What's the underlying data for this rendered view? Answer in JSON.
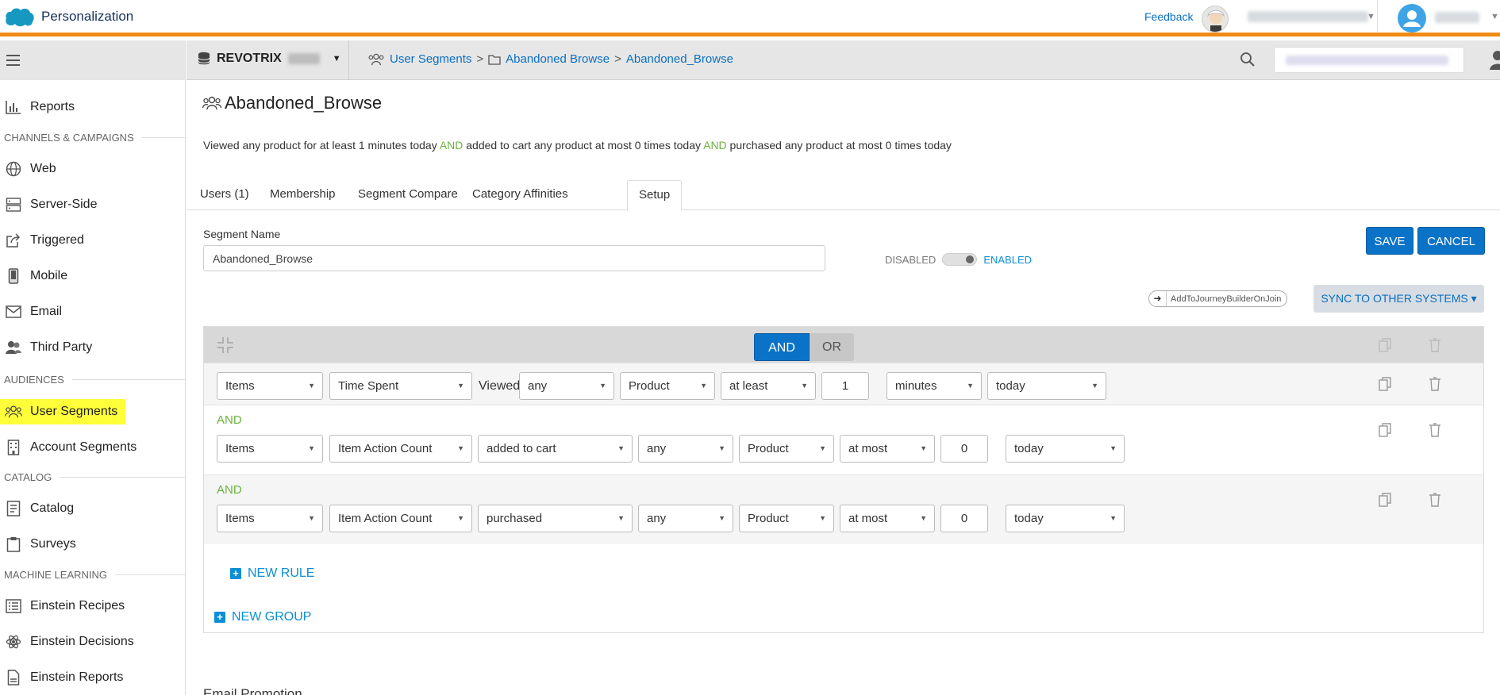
{
  "app": {
    "title": "Personalization",
    "feedback": "Feedback"
  },
  "colors": {
    "accent_orange": "#ef8a13",
    "primary_blue": "#0b73c7",
    "link_blue": "#0b6fc2",
    "operator_green": "#6cb33f",
    "highlight_yellow": "#ffff3a"
  },
  "sidebar": {
    "items": [
      {
        "label": "Reports",
        "icon": "bar-chart-icon"
      },
      {
        "section": "CHANNELS & CAMPAIGNS"
      },
      {
        "label": "Web",
        "icon": "globe-icon"
      },
      {
        "label": "Server-Side",
        "icon": "server-icon"
      },
      {
        "label": "Triggered",
        "icon": "share-icon"
      },
      {
        "label": "Mobile",
        "icon": "mobile-icon"
      },
      {
        "label": "Email",
        "icon": "envelope-icon"
      },
      {
        "label": "Third Party",
        "icon": "people-icon"
      },
      {
        "section": "AUDIENCES"
      },
      {
        "label": "User Segments",
        "icon": "users-icon",
        "active": true
      },
      {
        "label": "Account Segments",
        "icon": "building-icon"
      },
      {
        "section": "CATALOG"
      },
      {
        "label": "Catalog",
        "icon": "catalog-icon"
      },
      {
        "label": "Surveys",
        "icon": "clipboard-icon"
      },
      {
        "section": "MACHINE LEARNING"
      },
      {
        "label": "Einstein Recipes",
        "icon": "list-icon"
      },
      {
        "label": "Einstein Decisions",
        "icon": "atom-icon"
      },
      {
        "label": "Einstein Reports",
        "icon": "document-icon"
      }
    ]
  },
  "header": {
    "dataset": "REVOTRIX",
    "breadcrumb": [
      "User Segments",
      "Abandoned Browse",
      "Abandoned_Browse"
    ]
  },
  "page": {
    "title": "Abandoned_Browse",
    "summary": {
      "p1": "Viewed any product for at least 1 minutes today ",
      "op1": "AND",
      "p2": " added to cart any product at most 0 times today ",
      "op2": "AND",
      "p3": " purchased any product at most 0 times today"
    },
    "tabs": [
      "Users (1)",
      "Membership",
      "Segment Compare",
      "Category Affinities",
      "Setup"
    ],
    "active_tab": "Setup",
    "segment_name_label": "Segment Name",
    "segment_name_value": "Abandoned_Browse",
    "toggle": {
      "off_label": "DISABLED",
      "on_label": "ENABLED",
      "state": "enabled"
    },
    "save_label": "SAVE",
    "cancel_label": "CANCEL",
    "journey_label": "AddToJourneyBuilderOnJoin",
    "sync_label": "SYNC TO OTHER SYSTEMS ▾"
  },
  "builder": {
    "and_label": "AND",
    "or_label": "OR",
    "rules": [
      {
        "type": "Items",
        "metric": "Time Spent",
        "action": "Viewed",
        "qualifier": "any",
        "target": "Product",
        "comparator": "at least",
        "value": "1",
        "unit": "minutes",
        "period": "today"
      },
      {
        "join": "AND",
        "type": "Items",
        "metric": "Item Action Count",
        "action": "added to cart",
        "qualifier": "any",
        "target": "Product",
        "comparator": "at most",
        "value": "0",
        "period": "today"
      },
      {
        "join": "AND",
        "type": "Items",
        "metric": "Item Action Count",
        "action": "purchased",
        "qualifier": "any",
        "target": "Product",
        "comparator": "at most",
        "value": "0",
        "period": "today"
      }
    ],
    "new_rule_label": "NEW RULE",
    "new_group_label": "NEW GROUP"
  },
  "footer_cutoff": "Email Promotion"
}
